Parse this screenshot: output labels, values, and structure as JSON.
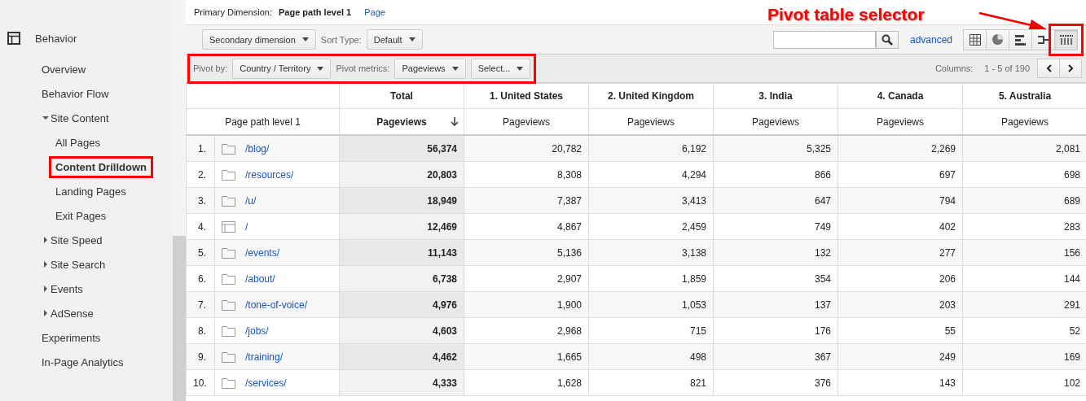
{
  "sidebar": {
    "section": {
      "label": "Behavior"
    },
    "items": [
      {
        "kind": "link",
        "label": "Overview",
        "selected": false,
        "highlighted": false
      },
      {
        "kind": "link",
        "label": "Behavior Flow",
        "selected": false,
        "highlighted": false
      },
      {
        "kind": "group",
        "label": "Site Content",
        "expanded": true,
        "selected": false,
        "highlighted": false,
        "children": [
          {
            "label": "All Pages",
            "selected": false,
            "highlighted": false
          },
          {
            "label": "Content Drilldown",
            "selected": true,
            "highlighted": true
          },
          {
            "label": "Landing Pages",
            "selected": false,
            "highlighted": false
          },
          {
            "label": "Exit Pages",
            "selected": false,
            "highlighted": false
          }
        ]
      },
      {
        "kind": "group",
        "label": "Site Speed",
        "expanded": false,
        "selected": false,
        "highlighted": false
      },
      {
        "kind": "group",
        "label": "Site Search",
        "expanded": false,
        "selected": false,
        "highlighted": false
      },
      {
        "kind": "group",
        "label": "Events",
        "expanded": false,
        "selected": false,
        "highlighted": false
      },
      {
        "kind": "group",
        "label": "AdSense",
        "expanded": false,
        "selected": false,
        "highlighted": false
      },
      {
        "kind": "link",
        "label": "Experiments",
        "selected": false,
        "highlighted": false
      },
      {
        "kind": "link",
        "label": "In-Page Analytics",
        "selected": false,
        "highlighted": false
      }
    ]
  },
  "primary_dimension": {
    "label": "Primary Dimension:",
    "options": [
      {
        "label": "Page path level 1",
        "selected": true
      },
      {
        "label": "Page",
        "selected": false
      }
    ]
  },
  "toolbar": {
    "secondary_dimension": "Secondary dimension",
    "sort_type_label": "Sort Type:",
    "sort_type": "Default",
    "advanced_link": "advanced",
    "view_buttons": [
      {
        "kind": "table",
        "selected": false,
        "highlighted": false
      },
      {
        "kind": "pie",
        "selected": false,
        "highlighted": false
      },
      {
        "kind": "bars",
        "selected": false,
        "highlighted": false
      },
      {
        "kind": "comparison",
        "selected": false,
        "highlighted": false
      },
      {
        "kind": "pivot",
        "selected": true,
        "highlighted": true
      }
    ]
  },
  "annotation": {
    "text": "Pivot table selector"
  },
  "pivot_bar": {
    "highlighted": true,
    "pivot_by_label": "Pivot by:",
    "pivot_by": "Country / Territory",
    "metrics_label": "Pivot metrics:",
    "metrics": [
      "Pageviews",
      "Select..."
    ],
    "columns_label": "Columns:",
    "columns_range": "1 - 5 of 190"
  },
  "table": {
    "groups": [
      "Total",
      "1. United States",
      "2. United Kingdom",
      "3. India",
      "4. Canada",
      "5. Australia"
    ],
    "dimension_header": "Page path level 1",
    "metric_headers": [
      {
        "label": "Pageviews",
        "sorted": true
      },
      {
        "label": "Pageviews",
        "sorted": false
      },
      {
        "label": "Pageviews",
        "sorted": false
      },
      {
        "label": "Pageviews",
        "sorted": false
      },
      {
        "label": "Pageviews",
        "sorted": false
      },
      {
        "label": "Pageviews",
        "sorted": false
      }
    ],
    "rows": [
      {
        "index": "1.",
        "kind": "folder",
        "path": "/blog/",
        "values": [
          "56,374",
          "20,782",
          "6,192",
          "5,325",
          "2,269",
          "2,081"
        ]
      },
      {
        "index": "2.",
        "kind": "folder",
        "path": "/resources/",
        "values": [
          "20,803",
          "8,308",
          "4,294",
          "866",
          "697",
          "698"
        ]
      },
      {
        "index": "3.",
        "kind": "folder",
        "path": "/u/",
        "values": [
          "18,949",
          "7,387",
          "3,413",
          "647",
          "794",
          "689"
        ]
      },
      {
        "index": "4.",
        "kind": "page",
        "path": "/",
        "values": [
          "12,469",
          "4,867",
          "2,459",
          "749",
          "402",
          "283"
        ]
      },
      {
        "index": "5.",
        "kind": "folder",
        "path": "/events/",
        "values": [
          "11,143",
          "5,136",
          "3,138",
          "132",
          "277",
          "156"
        ]
      },
      {
        "index": "6.",
        "kind": "folder",
        "path": "/about/",
        "values": [
          "6,738",
          "2,907",
          "1,859",
          "354",
          "206",
          "144"
        ]
      },
      {
        "index": "7.",
        "kind": "folder",
        "path": "/tone-of-voice/",
        "values": [
          "4,976",
          "1,900",
          "1,053",
          "137",
          "203",
          "291"
        ]
      },
      {
        "index": "8.",
        "kind": "folder",
        "path": "/jobs/",
        "values": [
          "4,603",
          "2,968",
          "715",
          "176",
          "55",
          "52"
        ]
      },
      {
        "index": "9.",
        "kind": "folder",
        "path": "/training/",
        "values": [
          "4,462",
          "1,665",
          "498",
          "367",
          "249",
          "169"
        ]
      },
      {
        "index": "10.",
        "kind": "folder",
        "path": "/services/",
        "values": [
          "4,333",
          "1,628",
          "821",
          "376",
          "143",
          "102"
        ]
      }
    ]
  }
}
